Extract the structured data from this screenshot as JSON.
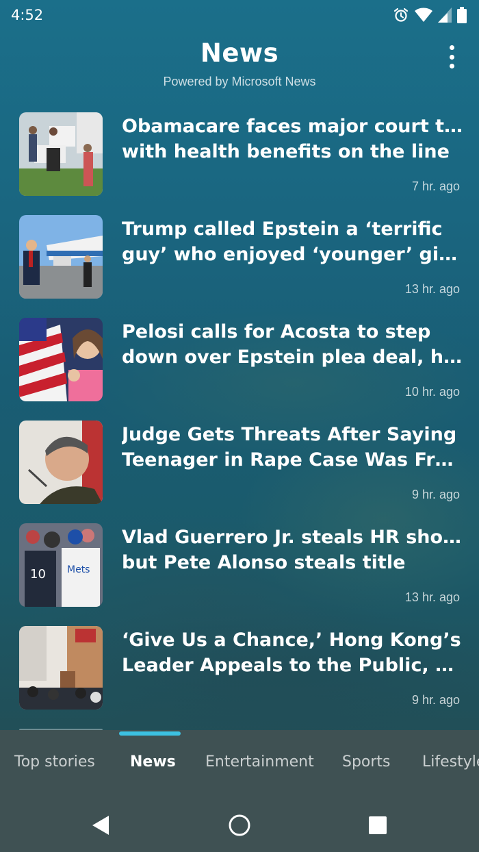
{
  "status_bar": {
    "time": "4:52"
  },
  "header": {
    "title": "News",
    "subtitle": "Powered by Microsoft News"
  },
  "articles": [
    {
      "line1": "Obamacare faces major court test",
      "line2": "with health benefits on the line",
      "time": "7 hr. ago",
      "thumb_icon": "protest-photo-thumbnail"
    },
    {
      "line1": "Trump called Epstein a ‘terrific",
      "line2": "guy’ who enjoyed ‘younger’ girl...",
      "time": "13 hr. ago",
      "thumb_icon": "airplane-photo-thumbnail"
    },
    {
      "line1": "Pelosi calls for Acosta to step",
      "line2": "down over Epstein plea deal, hit...",
      "time": "10 hr. ago",
      "thumb_icon": "flag-photo-thumbnail"
    },
    {
      "line1": "Judge Gets Threats After Saying",
      "line2": "Teenager in Rape Case Was From...",
      "time": "9 hr. ago",
      "thumb_icon": "portrait-photo-thumbnail"
    },
    {
      "line1": "Vlad Guerrero Jr. steals HR show,",
      "line2": "but Pete Alonso steals title",
      "time": "13 hr. ago",
      "thumb_icon": "baseball-photo-thumbnail"
    },
    {
      "line1": "‘Give Us a Chance,’ Hong Kong’s",
      "line2": "Leader Appeals to the Public, Say...",
      "time": "9 hr. ago",
      "thumb_icon": "press-conference-photo-thumbnail"
    }
  ],
  "tabs": [
    {
      "label": "Top stories",
      "active": false
    },
    {
      "label": "News",
      "active": true
    },
    {
      "label": "Entertainment",
      "active": false
    },
    {
      "label": "Sports",
      "active": false
    },
    {
      "label": "Lifestyle",
      "active": false
    }
  ],
  "colors": {
    "accent": "#3cc1e2",
    "tab_bar": "#3f5153"
  }
}
